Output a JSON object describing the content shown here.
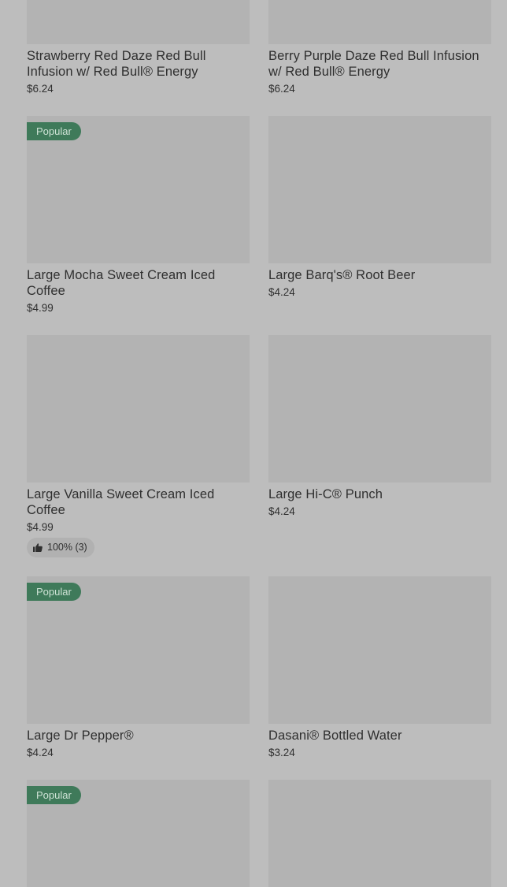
{
  "products": [
    {
      "name": "Strawberry Red Daze Red Bull Infusion w/ Red Bull® Energy",
      "price": "$6.24"
    },
    {
      "name": "Berry Purple Daze Red Bull Infusion w/ Red Bull® Energy",
      "price": "$6.24"
    },
    {
      "name": "Large Mocha Sweet Cream Iced Coffee",
      "price": "$4.99",
      "badge": "Popular"
    },
    {
      "name": "Large Barq's® Root Beer",
      "price": "$4.24"
    },
    {
      "name": "Large Vanilla Sweet Cream Iced Coffee",
      "price": "$4.99",
      "rating": "100% (3)"
    },
    {
      "name": "Large Hi-C® Punch",
      "price": "$4.24"
    },
    {
      "name": "Large Dr Pepper®",
      "price": "$4.24",
      "badge": "Popular"
    },
    {
      "name": "Dasani® Bottled Water",
      "price": "$3.24"
    },
    {
      "badge": "Popular"
    },
    {}
  ],
  "icons": {
    "rating": "thumbs-up-icon"
  },
  "colors": {
    "background": "#bdbdbd",
    "image_placeholder": "#b3b3b3",
    "badge": "#3f7a5a",
    "text": "#2f2f2f"
  }
}
